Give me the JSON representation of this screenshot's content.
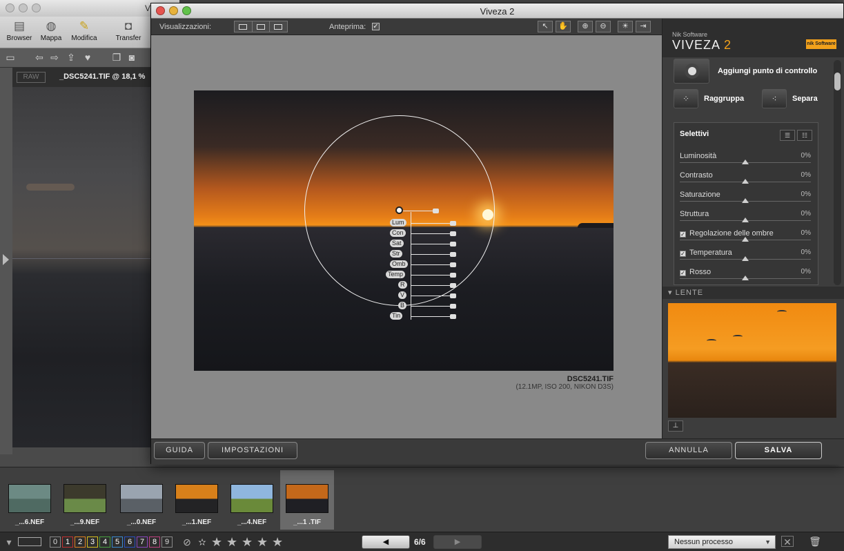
{
  "bg_window": {
    "title": "V",
    "toolbar": [
      "Browser",
      "Mappa",
      "Modifica",
      "Transfer"
    ],
    "raw_label": "RAW",
    "document_title": "_DSC5241.TIF @ 18,1 %"
  },
  "viveza": {
    "title": "Viveza 2",
    "toolbar": {
      "views_label": "Visualizzazioni:",
      "preview_label": "Anteprima:",
      "preview_checked": true
    },
    "photo": {
      "filename": "DSC5241.TIF",
      "meta": "(12.1MP, ISO 200, NIKON D3S)"
    },
    "control_point_labels": [
      "Lum",
      "Con",
      "Sat",
      "Str",
      "Omb",
      "Temp",
      "R",
      "V",
      "B",
      "Tin"
    ],
    "panel": {
      "brand_small": "Nik Software",
      "brand": "VIVEZA",
      "brand_version": "2",
      "logo_text": "nik Software",
      "add_control_point": "Aggiungi punto di controllo",
      "group": "Raggruppa",
      "separate": "Separa",
      "selective_title": "Selettivi",
      "sliders": [
        {
          "label": "Luminosità",
          "value": "0%",
          "checkbox": false
        },
        {
          "label": "Contrasto",
          "value": "0%",
          "checkbox": false
        },
        {
          "label": "Saturazione",
          "value": "0%",
          "checkbox": false
        },
        {
          "label": "Struttura",
          "value": "0%",
          "checkbox": false
        },
        {
          "label": "Regolazione delle ombre",
          "value": "0%",
          "checkbox": true
        },
        {
          "label": "Temperatura",
          "value": "0%",
          "checkbox": true
        },
        {
          "label": "Rosso",
          "value": "0%",
          "checkbox": true
        }
      ],
      "lens_label": "LENTE"
    },
    "buttons": {
      "guide": "GUIDA",
      "settings": "IMPOSTAZIONI",
      "cancel": "ANNULLA",
      "save": "SALVA"
    }
  },
  "filmstrip": {
    "items": [
      {
        "label": "_...6.NEF",
        "colors": [
          "#6c8a84",
          "#4f6a62"
        ]
      },
      {
        "label": "_...9.NEF",
        "colors": [
          "#3c3a2c",
          "#6a8a48"
        ]
      },
      {
        "label": "_...0.NEF",
        "colors": [
          "#9aa4b0",
          "#5a6066"
        ]
      },
      {
        "label": "_...1.NEF",
        "colors": [
          "#d8801a",
          "#232325"
        ]
      },
      {
        "label": "_...4.NEF",
        "colors": [
          "#8fb6de",
          "#6a8a3a"
        ]
      },
      {
        "label": "_...1 .TIF",
        "colors": [
          "#c4681a",
          "#1f1f24"
        ]
      }
    ],
    "selected_index": 5
  },
  "bottom_bar": {
    "labels": [
      "0",
      "1",
      "2",
      "3",
      "4",
      "5",
      "6",
      "7",
      "8",
      "9"
    ],
    "label_colors": [
      "#888888",
      "#c23030",
      "#e08020",
      "#d8c020",
      "#48a040",
      "#3a8ad0",
      "#2a50c0",
      "#8a48c0",
      "#c04080",
      "#888888"
    ],
    "page_count": "6/6",
    "process_select": "Nessun processo"
  }
}
